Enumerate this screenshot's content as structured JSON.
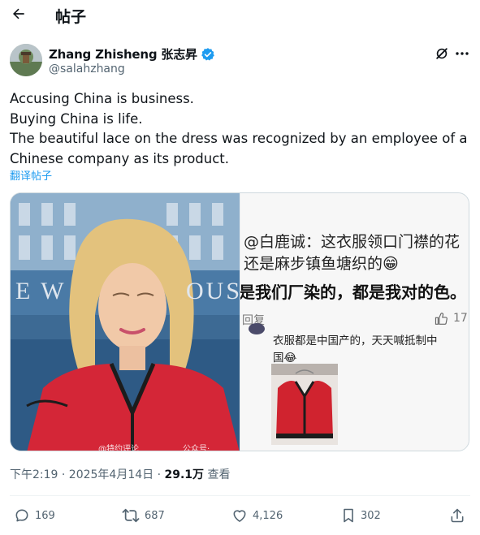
{
  "header": {
    "title": "帖子"
  },
  "author": {
    "display_name": "Zhang Zhisheng 张志昇",
    "handle": "@salahzhang",
    "verified_color": "#1d9bf0"
  },
  "post": {
    "lines": [
      "Accusing China is business.",
      "Buying China is life.",
      "The beautiful lace on the dress was recognized by an employee of a",
      "Chinese company as its product."
    ],
    "translate_label": "翻译帖子"
  },
  "media": {
    "left_building_text": "E W",
    "left_building_text_2": "OUS",
    "left_watermark_1": "@特约评论",
    "left_watermark_2": "公众号·",
    "right_lines": [
      "@白鹿诚：这衣服领口门襟的花",
      "还是麻步镇鱼塘织的😁",
      "是我们厂染的，都是我对的色。"
    ],
    "right_reply_label": "回复",
    "right_like_count": "17",
    "right_comment_lines": [
      "衣服都是中国产的，天天喊抵制中",
      "国😂"
    ]
  },
  "meta": {
    "time": "下午2:19 · 2025年4月14日 · ",
    "views": "29.1万",
    "views_label": " 查看"
  },
  "actions": {
    "replies": "169",
    "reposts": "687",
    "likes": "4,126",
    "bookmarks": "302"
  },
  "icons": {
    "back": "back-arrow-icon",
    "grok": "grok-icon",
    "more": "more-icon",
    "reply": "reply-icon",
    "repost": "repost-icon",
    "like": "heart-icon",
    "bookmark": "bookmark-icon",
    "share": "share-icon"
  }
}
